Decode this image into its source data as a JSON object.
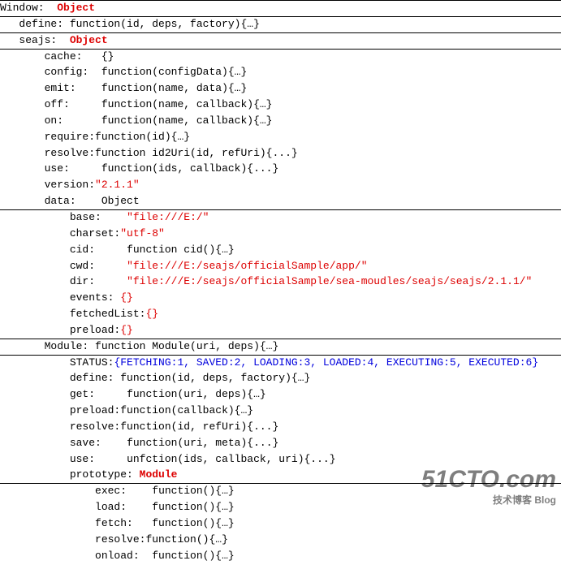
{
  "window": {
    "label": "Window:",
    "type": "Object",
    "define": {
      "key": "define:",
      "sig": "function(id, deps, factory){…}"
    },
    "seajs": {
      "key": "seajs:",
      "type": "Object",
      "cache": {
        "key": "cache:",
        "sig": "{}"
      },
      "config": {
        "key": "config:",
        "sig": "function(configData){…}"
      },
      "emit": {
        "key": "emit:",
        "sig": "function(name, data){…}"
      },
      "off": {
        "key": "off:",
        "sig": "function(name, callback){…}"
      },
      "on": {
        "key": "on:",
        "sig": "function(name, callback){…}"
      },
      "require": {
        "key": "require:",
        "sig": "function(id){…}"
      },
      "resolve": {
        "key": "resolve:",
        "sig": "function id2Uri(id, refUri){...}"
      },
      "use": {
        "key": "use:",
        "sig": "function(ids, callback){...}"
      },
      "version": {
        "key": "version:",
        "val": "\"2.1.1\""
      },
      "data": {
        "key": "data:",
        "type": "Object",
        "base": {
          "key": "base:",
          "val": "\"file:///E:/\""
        },
        "charset": {
          "key": "charset:",
          "val": "\"utf-8\""
        },
        "cid": {
          "key": "cid:",
          "sig": "function cid(){…}"
        },
        "cwd": {
          "key": "cwd:",
          "val": "\"file:///E:/seajs/officialSample/app/\""
        },
        "dir": {
          "key": "dir:",
          "val": "\"file:///E:/seajs/officialSample/sea-moudles/seajs/seajs/2.1.1/\""
        },
        "events": {
          "key": "events:",
          "val": "{}"
        },
        "fetchedList": {
          "key": "fetchedList:",
          "val": "{}"
        },
        "preload": {
          "key": "preload:",
          "val": "{}"
        }
      },
      "Module": {
        "key": "Module:",
        "sig": "function Module(uri, deps){…}",
        "STATUS": {
          "key": "STATUS:",
          "val": "{FETCHING:1, SAVED:2, LOADING:3, LOADED:4, EXECUTING:5, EXECUTED:6}"
        },
        "define": {
          "key": "define:",
          "sig": "function(id, deps, factory){…}"
        },
        "get": {
          "key": "get:",
          "sig": "function(uri, deps){…}"
        },
        "preload": {
          "key": "preload:",
          "sig": "function(callback){…}"
        },
        "resolve": {
          "key": "resolve:",
          "sig": "function(id, refUri){...}"
        },
        "save": {
          "key": "save:",
          "sig": "function(uri, meta){...}"
        },
        "use": {
          "key": "use:",
          "sig": "unfction(ids, callback, uri){...}"
        },
        "prototype": {
          "key": "prototype:",
          "type": "Module",
          "exec": {
            "key": "exec:",
            "sig": "function(){…}"
          },
          "load": {
            "key": "load:",
            "sig": "function(){…}"
          },
          "fetch": {
            "key": "fetch:",
            "sig": "function(){…}"
          },
          "resolve": {
            "key": "resolve:",
            "sig": "function(){…}"
          },
          "onload": {
            "key": "onload:",
            "sig": "function(){…}"
          }
        }
      }
    }
  },
  "watermark": {
    "brand": "51CTO.com",
    "tagline": "技术博客  Blog"
  }
}
